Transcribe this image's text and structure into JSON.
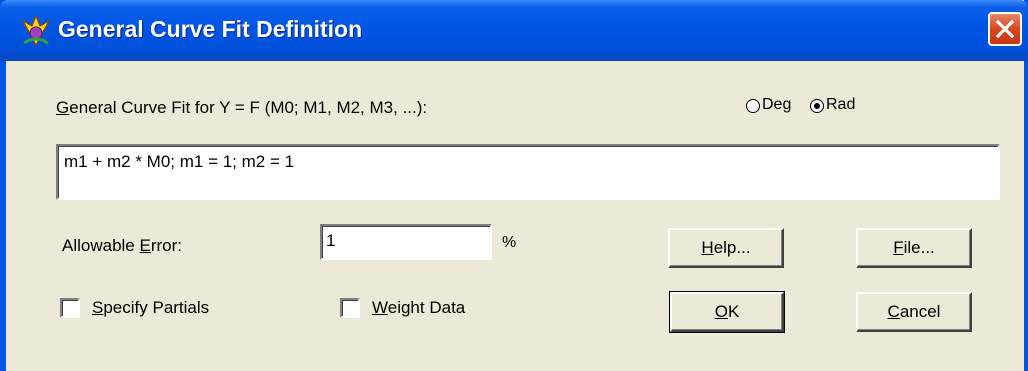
{
  "window": {
    "title": "General Curve Fit Definition",
    "accent": "#0054e3",
    "close_color": "#d9461f"
  },
  "formula": {
    "label_accel": "G",
    "label_rest": "eneral Curve Fit for Y = F (M0;  M1, M2, M3, ...):",
    "value": "m1 + m2 * M0; m1 = 1; m2 = 1"
  },
  "angle": {
    "deg_label": "Deg",
    "rad_label": "Rad",
    "selected": "Rad"
  },
  "error": {
    "label_before": "Allowable ",
    "label_accel": "E",
    "label_after": "rror:",
    "value": "1",
    "unit": "%"
  },
  "options": {
    "partials_accel": "S",
    "partials_rest": "pecify Partials",
    "partials_checked": false,
    "weight_accel": "W",
    "weight_rest": "eight Data",
    "weight_checked": false
  },
  "buttons": {
    "help_accel": "H",
    "help_rest": "elp...",
    "file_accel": "F",
    "file_rest": "ile...",
    "ok_accel": "O",
    "ok_rest": "K",
    "cancel_accel": "C",
    "cancel_rest": "ancel"
  }
}
